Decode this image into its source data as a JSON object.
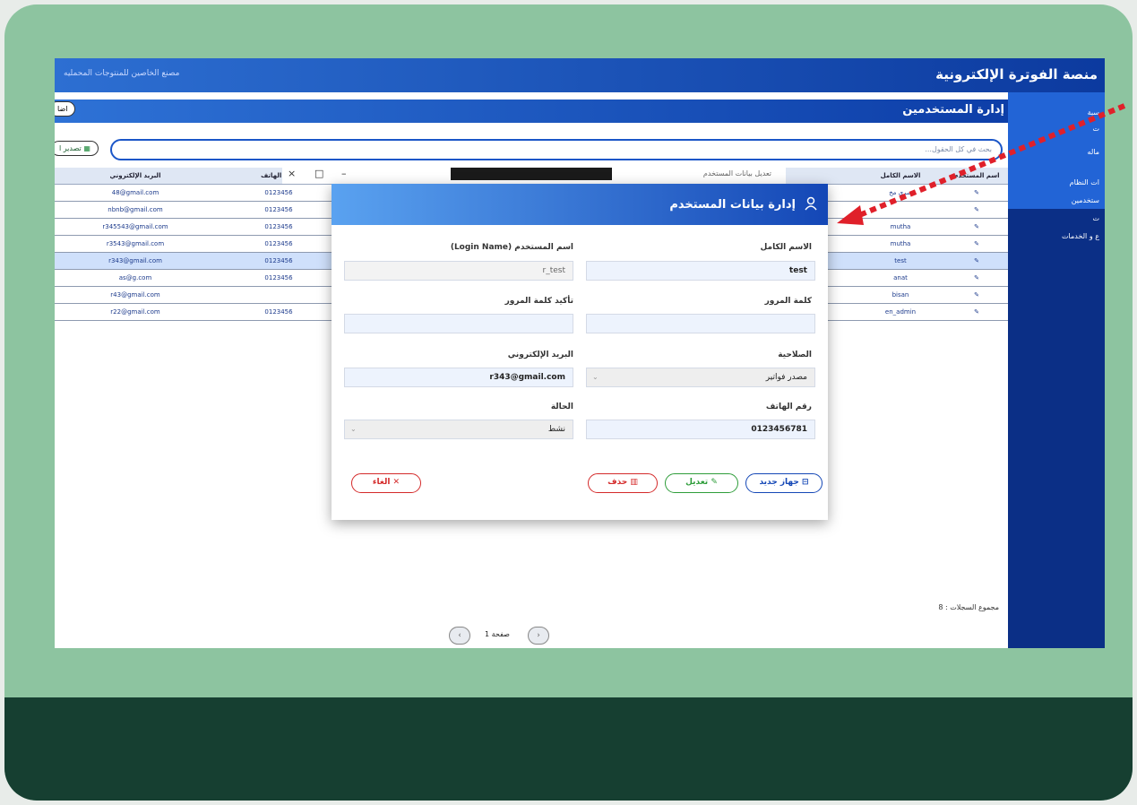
{
  "app": {
    "title": "منصة الفوترة الإلكترونية",
    "breadcrumb": "مصنع الخاصين للمنتوجات المحمليه"
  },
  "sidebar": {
    "items": [
      "سبة",
      "ت",
      "ماله",
      "ات النظام",
      "ستخدمين",
      "ت",
      "ع و الخدمات"
    ]
  },
  "page": {
    "title": "إدارة المستخدمين",
    "add_label": "اضا",
    "export_label": "تصدير ا",
    "search_placeholder": "بحث في كل الحقول..."
  },
  "table": {
    "headers": [
      "البريد الإلكتروني",
      "رقم الهاتف",
      "الاسم الكامل",
      "اسم المستخدم"
    ],
    "rows": [
      {
        "email": "48@gmail.com",
        "phone": "0123456",
        "name": "سري مخ"
      },
      {
        "email": "nbnb@gmail.com",
        "phone": "0123456",
        "name": ""
      },
      {
        "email": "r345543@gmail.com",
        "phone": "0123456",
        "name": "mutha"
      },
      {
        "email": "r3543@gmail.com",
        "phone": "0123456",
        "name": "mutha"
      },
      {
        "email": "r343@gmail.com",
        "phone": "0123456",
        "name": "test"
      },
      {
        "email": "as@g.com",
        "phone": "0123456",
        "name": "anat"
      },
      {
        "email": "r43@gmail.com",
        "phone": "",
        "name": "bisan"
      },
      {
        "email": "r22@gmail.com",
        "phone": "0123456",
        "name": "en_admin"
      }
    ],
    "total_label": "مجموع السجلات :",
    "total_count": "8",
    "page_label": "صفحة 1"
  },
  "window_tab": "تعديل بيانات المستخدم",
  "dialog": {
    "title": "إدارة بيانات المستخدم",
    "fullname_label": "الاسم الكامل",
    "fullname_value": "test",
    "username_label": "اسم المستخدم (Login Name)",
    "username_value": "r_test",
    "password_label": "كلمة المرور",
    "confirm_label": "تأكيد كلمة المرور",
    "role_label": "الصلاحية",
    "role_value": "مصدر فواتير",
    "email_label": "البريد الإلكتروني",
    "email_value": "r343@gmail.com",
    "phone_label": "رقم الهاتف",
    "phone_value": "0123456781",
    "status_label": "الحالة",
    "status_value": "نشط",
    "new_button": "جهاز جديد",
    "edit_button": "تعديل",
    "delete_button": "حذف",
    "cancel_button": "الغاء"
  },
  "colors": {
    "frame": "#8dc4a0",
    "frame_dark": "#163f31",
    "primary": "#1447b6",
    "danger": "#d42a2a",
    "success": "#2e9d3a"
  }
}
